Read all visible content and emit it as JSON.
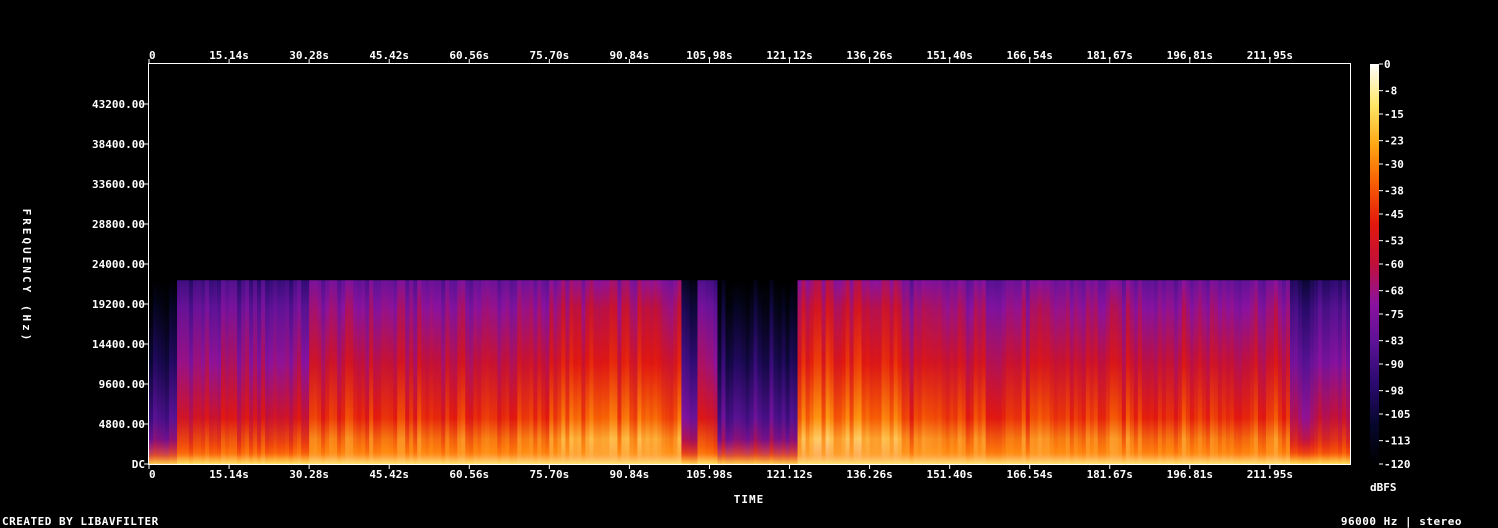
{
  "chart_data": {
    "type": "heatmap",
    "title": "",
    "xlabel": "TIME",
    "ylabel": "FREQUENCY (Hz)",
    "colorbar_label": "dBFS",
    "x_ticks": [
      "0",
      "15.14s",
      "30.28s",
      "45.42s",
      "60.56s",
      "75.70s",
      "90.84s",
      "105.98s",
      "121.12s",
      "136.26s",
      "151.40s",
      "166.54s",
      "181.67s",
      "196.81s",
      "211.95s"
    ],
    "x_tick_values": [
      0,
      15.14,
      30.28,
      45.42,
      60.56,
      75.7,
      90.84,
      105.98,
      121.12,
      136.26,
      151.4,
      166.54,
      181.67,
      196.81,
      211.95
    ],
    "x_range": [
      0,
      227.1
    ],
    "y_ticks": [
      "DC",
      "4800.00",
      "9600.00",
      "14400.00",
      "19200.00",
      "24000.00",
      "28800.00",
      "33600.00",
      "38400.00",
      "43200.00"
    ],
    "y_tick_values": [
      0,
      4800,
      9600,
      14400,
      19200,
      24000,
      28800,
      33600,
      38400,
      43200
    ],
    "y_range": [
      0,
      48000
    ],
    "colorbar_ticks": [
      "0",
      "-8",
      "-15",
      "-23",
      "-30",
      "-38",
      "-45",
      "-53",
      "-60",
      "-68",
      "-75",
      "-83",
      "-90",
      "-98",
      "-105",
      "-113",
      "-120"
    ],
    "colorbar_range": [
      -120,
      0
    ],
    "content_bandwidth_hz": 22050,
    "segments": [
      {
        "start": 0,
        "end": 5.5,
        "level": -95
      },
      {
        "start": 5.5,
        "end": 30.28,
        "level": -62
      },
      {
        "start": 30.28,
        "end": 75.7,
        "level": -52
      },
      {
        "start": 75.7,
        "end": 100.5,
        "level": -44
      },
      {
        "start": 100.5,
        "end": 103.5,
        "level": -80
      },
      {
        "start": 103.5,
        "end": 107.5,
        "level": -58
      },
      {
        "start": 107.5,
        "end": 122.5,
        "level": -92
      },
      {
        "start": 122.5,
        "end": 142.0,
        "level": -40
      },
      {
        "start": 142.0,
        "end": 215.5,
        "level": -50
      },
      {
        "start": 215.5,
        "end": 221.0,
        "level": -75
      },
      {
        "start": 221.0,
        "end": 227.1,
        "level": -66
      }
    ],
    "colormap": [
      "#000000",
      "#07072e",
      "#2a0a6e",
      "#5a1294",
      "#8a12a0",
      "#c0103a",
      "#e2180e",
      "#f65c04",
      "#ffa814",
      "#ffe86a",
      "#ffffff"
    ]
  },
  "footer": {
    "left": "CREATED BY LIBAVFILTER",
    "right": "96000 Hz | stereo"
  }
}
